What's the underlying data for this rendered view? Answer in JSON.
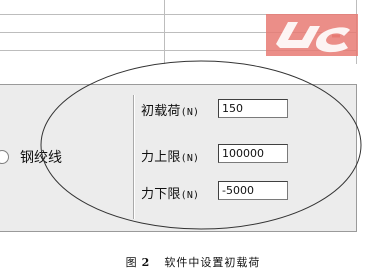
{
  "watermark": {
    "name": "logo-watermark",
    "colors": {
      "primary": "#d9534f",
      "accent": "#f2b4b0"
    }
  },
  "panel": {
    "option_label": "钢绞线",
    "fields": [
      {
        "label": "初载荷",
        "unit": "(N)",
        "value": "150"
      },
      {
        "label": "力上限",
        "unit": "(N)",
        "value": "100000"
      },
      {
        "label": "力下限",
        "unit": "(N)",
        "value": "-5000"
      }
    ]
  },
  "caption": {
    "fig": "图",
    "num": "2",
    "text": "软件中设置初载荷"
  }
}
